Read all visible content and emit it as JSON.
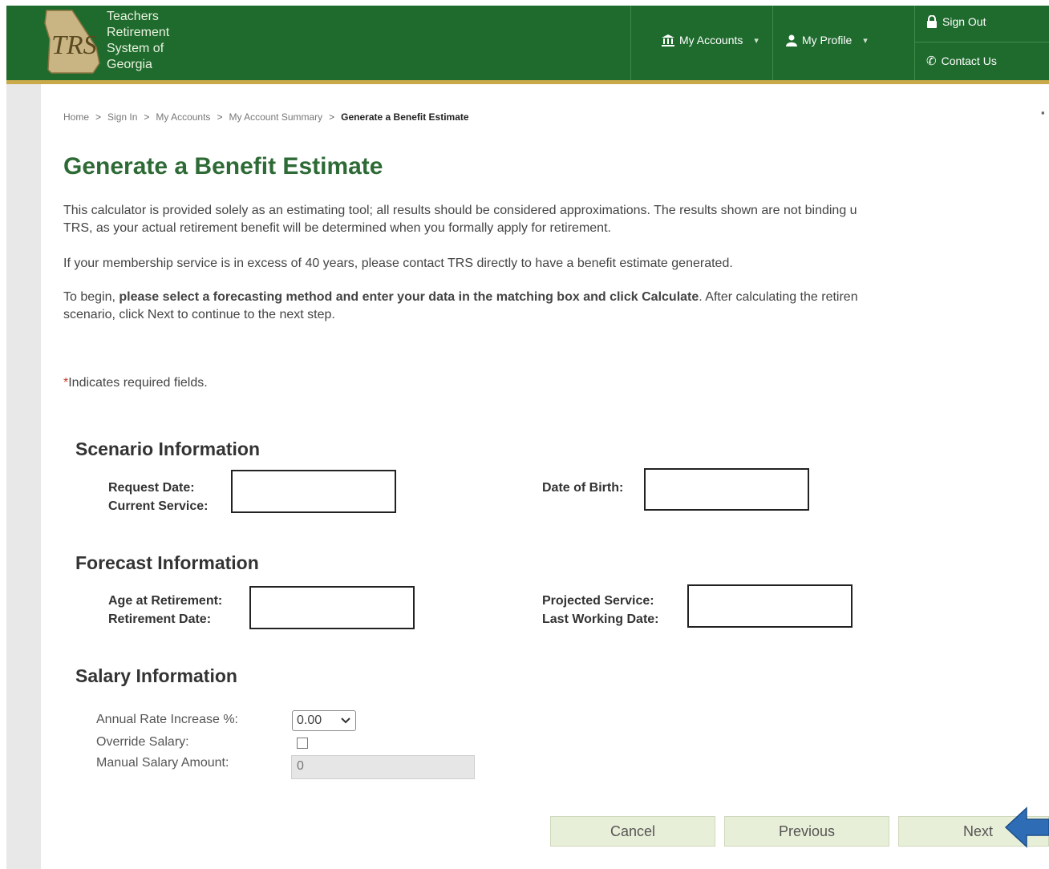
{
  "header": {
    "org_name": [
      "Teachers",
      "Retirement",
      "System of",
      "Georgia"
    ],
    "logo_text": "TRS",
    "nav": {
      "my_accounts": "My Accounts",
      "my_profile": "My Profile",
      "sign_out": "Sign Out",
      "contact_us": "Contact Us"
    },
    "colors": {
      "header_bg": "#1f6b2e",
      "accent_strip": "#c9a94a"
    }
  },
  "breadcrumb": [
    "Home",
    "Sign In",
    "My Accounts",
    "My Account Summary",
    "Generate a Benefit Estimate"
  ],
  "page": {
    "title": "Generate a Benefit Estimate",
    "intro_line1": "This calculator is provided solely as an estimating tool; all results should be considered approximations. The results shown are not binding u",
    "intro_line2": "TRS, as your actual retirement benefit will be determined when you formally apply for retirement.",
    "service_note": "If your membership service is in excess of 40 years, please contact TRS directly to have a benefit estimate generated.",
    "begin_prefix": "To begin, ",
    "begin_bold": "please select a forecasting method and enter your data in the matching box and click Calculate",
    "begin_suffix": ". After calculating the retiren",
    "begin_line2": "scenario, click Next to continue to the next step.",
    "required_star": "*",
    "required_text": "Indicates required fields."
  },
  "scenario": {
    "title": "Scenario Information",
    "request_date_label": "Request Date:",
    "current_service_label": "Current Service:",
    "date_of_birth_label": "Date of Birth:"
  },
  "forecast": {
    "title": "Forecast Information",
    "age_label": "Age at Retirement:",
    "retirement_date_label": "Retirement Date:",
    "projected_service_label": "Projected Service:",
    "last_working_date_label": "Last Working Date:"
  },
  "salary": {
    "title": "Salary Information",
    "rate_label": "Annual Rate Increase %:",
    "rate_value": "0.00",
    "override_label": "Override Salary:",
    "manual_label": "Manual Salary Amount:",
    "manual_value": "0"
  },
  "buttons": {
    "cancel": "Cancel",
    "previous": "Previous",
    "next": "Next"
  },
  "annotation": {
    "arrow_color": "#2e6db5"
  }
}
